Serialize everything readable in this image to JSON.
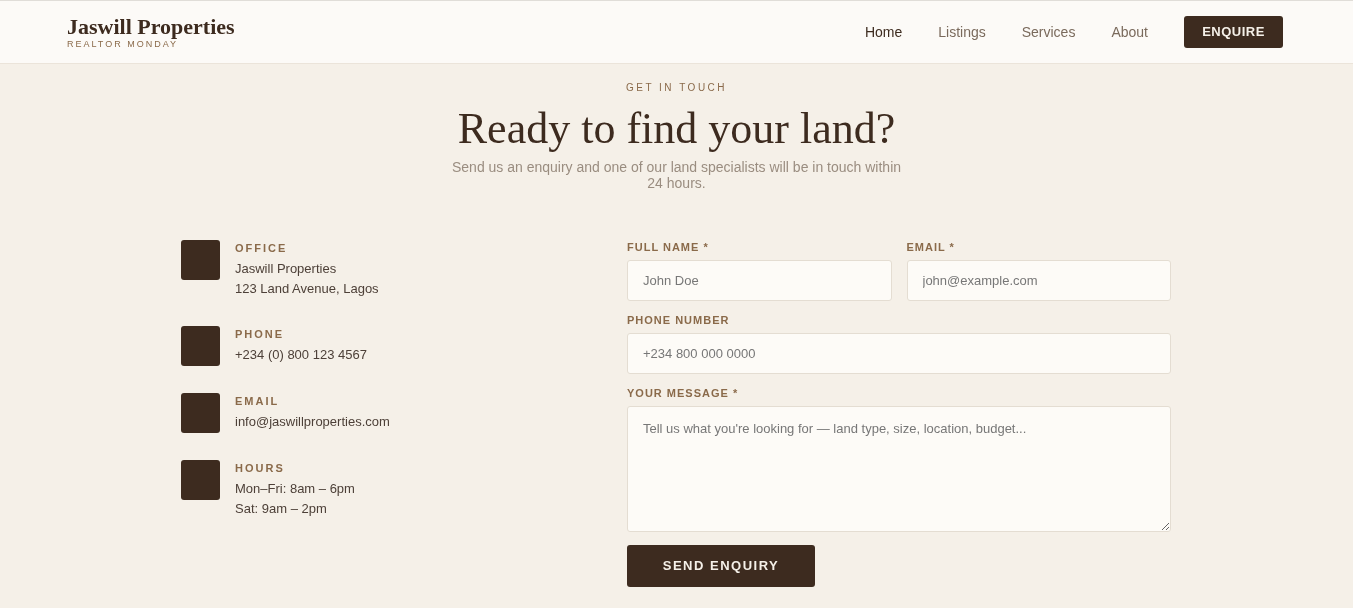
{
  "brand": {
    "name": "Jaswill Properties",
    "tagline": "REALTOR MONDAY"
  },
  "nav": [
    {
      "label": "Home",
      "selected": true
    },
    {
      "label": "Listings",
      "selected": false
    },
    {
      "label": "Services",
      "selected": false
    },
    {
      "label": "About",
      "selected": false
    }
  ],
  "nav_button": "ENQUIRE",
  "hero": {
    "eyebrow": "GET IN TOUCH",
    "title": "Ready to find your land?",
    "subtitle": "Send us an enquiry and one of our land specialists will be in touch within 24 hours."
  },
  "contacts": [
    {
      "label": "OFFICE",
      "lines": [
        "Jaswill Properties",
        "123 Land Avenue, Lagos"
      ]
    },
    {
      "label": "PHONE",
      "lines": [
        "+234 (0) 800 123 4567"
      ]
    },
    {
      "label": "EMAIL",
      "lines": [
        "info@jaswillproperties.com"
      ]
    },
    {
      "label": "HOURS",
      "lines": [
        "Mon–Fri: 8am – 6pm",
        "Sat: 9am – 2pm"
      ]
    }
  ],
  "form": {
    "fields": [
      {
        "label": "FULL NAME *",
        "placeholder": "John Doe",
        "kind": "half"
      },
      {
        "label": "EMAIL *",
        "placeholder": "john@example.com",
        "kind": "half"
      },
      {
        "label": "PHONE NUMBER",
        "placeholder": "+234 800 000 0000",
        "kind": "full"
      },
      {
        "label": "YOUR MESSAGE *",
        "placeholder": "Tell us what you're looking for — land type, size, location, budget...",
        "kind": "textarea"
      }
    ],
    "submit": "SEND ENQUIRY"
  }
}
